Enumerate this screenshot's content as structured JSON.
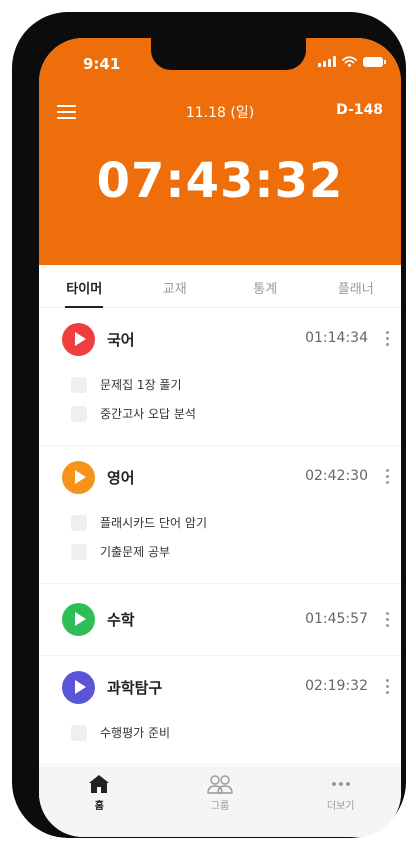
{
  "status_bar": {
    "time": "9:41"
  },
  "header": {
    "date": "11.18 (일)",
    "dday": "D-148",
    "timer": "07:43:32"
  },
  "tabs": [
    {
      "label": "타이머",
      "active": true
    },
    {
      "label": "교재",
      "active": false
    },
    {
      "label": "통계",
      "active": false
    },
    {
      "label": "플래너",
      "active": false
    }
  ],
  "subjects": [
    {
      "name": "국어",
      "time": "01:14:34",
      "color": "#ef3e3e",
      "tasks": [
        "문제집 1장 풀기",
        "중간고사 오답 분석"
      ]
    },
    {
      "name": "영어",
      "time": "02:42:30",
      "color": "#f7931a",
      "tasks": [
        "플래시카드 단어 암기",
        "기출문제 공부"
      ]
    },
    {
      "name": "수학",
      "time": "01:45:57",
      "color": "#2fbd58",
      "tasks": []
    },
    {
      "name": "과학탐구",
      "time": "02:19:32",
      "color": "#5a55d6",
      "tasks": [
        "수행평가 준비"
      ]
    }
  ],
  "partial_subject_color": "#9b4fd3",
  "bottom_nav": [
    {
      "label": "홈",
      "icon": "home-icon",
      "active": true
    },
    {
      "label": "그룹",
      "icon": "group-icon",
      "active": false
    },
    {
      "label": "더보기",
      "icon": "more-icon",
      "active": false
    }
  ],
  "colors": {
    "accent": "#ee6e0b"
  }
}
